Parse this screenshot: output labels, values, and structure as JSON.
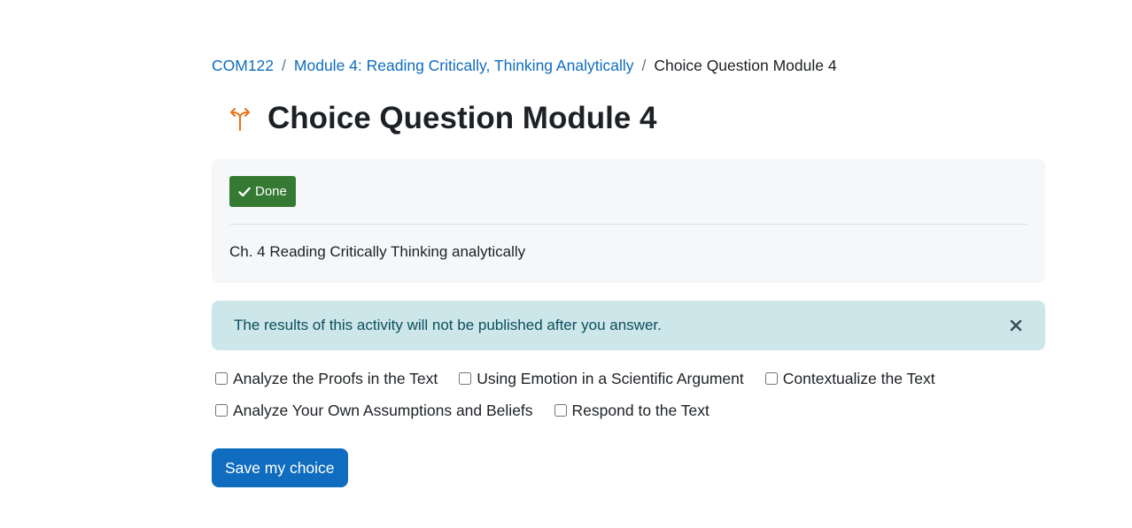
{
  "breadcrumb": {
    "items": [
      {
        "label": "COM122"
      },
      {
        "label": "Module 4: Reading Critically, Thinking Analytically"
      }
    ],
    "separator": "/",
    "current": "Choice Question Module 4"
  },
  "page": {
    "title": "Choice Question Module 4",
    "title_icon": "choice-activity-icon"
  },
  "completion": {
    "label": "Done",
    "icon": "check-icon",
    "color": "#357a32"
  },
  "description": "Ch. 4 Reading Critically Thinking analytically",
  "alert": {
    "message": "The results of this activity will not be published after you answer.",
    "close_icon": "close-icon"
  },
  "options": [
    {
      "label": "Analyze the Proofs in the Text",
      "checked": false
    },
    {
      "label": "Using Emotion in a Scientific Argument",
      "checked": false
    },
    {
      "label": "Contextualize the Text",
      "checked": false
    },
    {
      "label": "Analyze Your Own Assumptions and Beliefs",
      "checked": false
    },
    {
      "label": "Respond to the Text",
      "checked": false
    }
  ],
  "save_button": {
    "label": "Save my choice"
  },
  "colors": {
    "link": "#0f6cbf",
    "primary": "#0f6cbf",
    "success": "#357a32",
    "icon_accent": "#e6731e",
    "info_bg": "#cce6ea",
    "info_text": "#0d4f5c"
  }
}
